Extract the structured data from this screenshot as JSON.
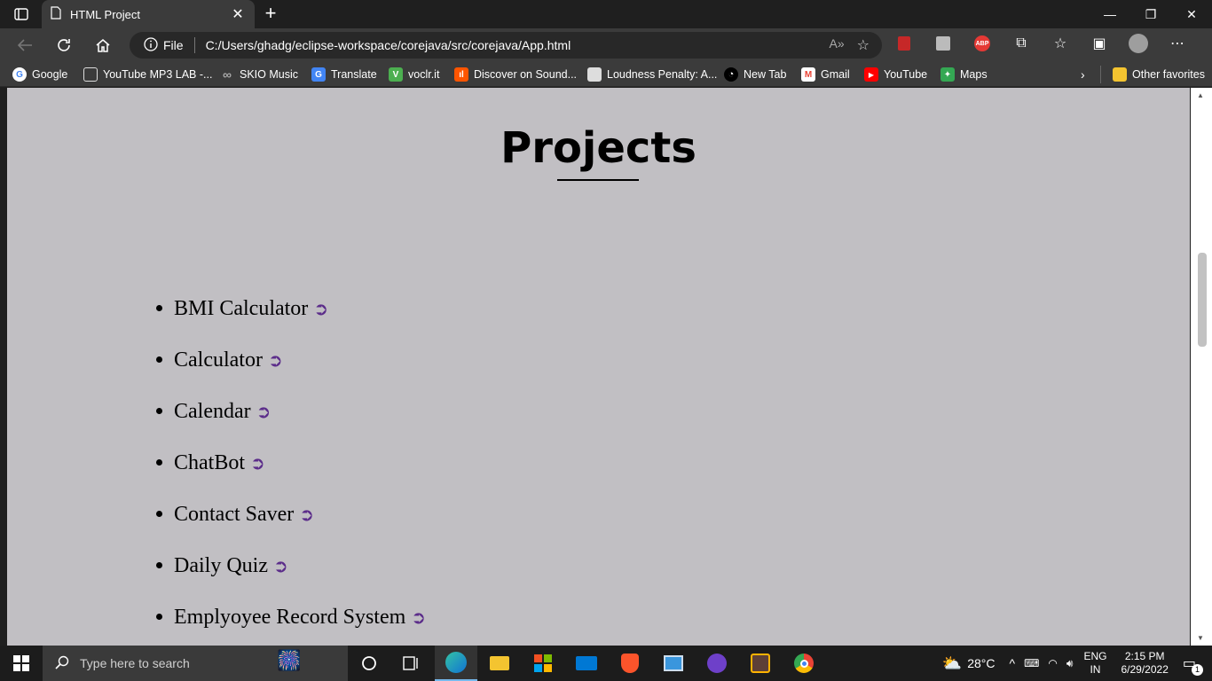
{
  "browser": {
    "tab_title": "HTML Project",
    "address_label": "File",
    "url": "C:/Users/ghadg/eclipse-workspace/corejava/src/corejava/App.html"
  },
  "bookmarks": [
    {
      "label": "Google",
      "color": "#ffffff",
      "glyph": "G"
    },
    {
      "label": "YouTube MP3 LAB -...",
      "color": "#3b3b3b",
      "glyph": ""
    },
    {
      "label": "SKIO Music",
      "color": "#3b3b3b",
      "glyph": "∞"
    },
    {
      "label": "Translate",
      "color": "#4285f4",
      "glyph": "G"
    },
    {
      "label": "voclr.it",
      "color": "#4caf50",
      "glyph": "V"
    },
    {
      "label": "Discover on Sound...",
      "color": "#ff5500",
      "glyph": "ıl"
    },
    {
      "label": "Loudness Penalty: A...",
      "color": "#dddddd",
      "glyph": ""
    },
    {
      "label": "New Tab",
      "color": "#000000",
      "glyph": "◔"
    },
    {
      "label": "Gmail",
      "color": "#ea4335",
      "glyph": "M"
    },
    {
      "label": "YouTube",
      "color": "#ff0000",
      "glyph": "▶"
    },
    {
      "label": "Maps",
      "color": "#34a853",
      "glyph": "✦"
    }
  ],
  "other_favorites": "Other favorites",
  "page": {
    "title": "Projects",
    "projects": [
      {
        "label": "BMI Calculator",
        "arrow": "➲"
      },
      {
        "label": "Calculator",
        "arrow": "➲"
      },
      {
        "label": "Calendar",
        "arrow": "➲"
      },
      {
        "label": "ChatBot",
        "arrow": "➲"
      },
      {
        "label": "Contact Saver",
        "arrow": "➲"
      },
      {
        "label": "Daily Quiz",
        "arrow": "➲"
      },
      {
        "label": "Emplyoyee Record System",
        "arrow": "➲"
      }
    ]
  },
  "taskbar": {
    "search_placeholder": "Type here to search",
    "weather": "28°C",
    "lang_top": "ENG",
    "lang_bottom": "IN",
    "time": "2:15 PM",
    "date": "6/29/2022",
    "notifications": "1"
  }
}
